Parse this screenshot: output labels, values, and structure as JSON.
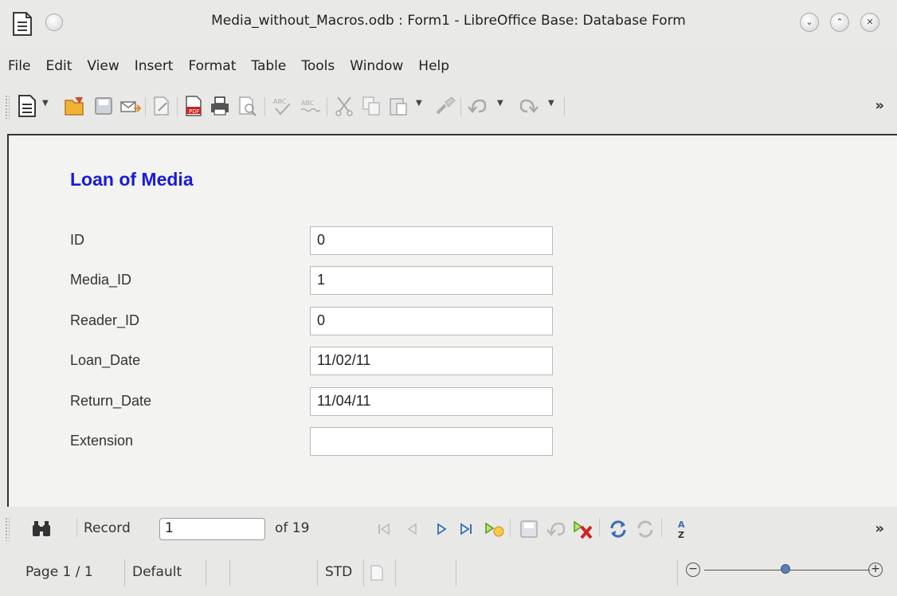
{
  "window": {
    "title": "Media_without_Macros.odb : Form1 - LibreOffice Base: Database Form",
    "controls": [
      "minimize",
      "maximize",
      "close"
    ]
  },
  "menu": [
    "File",
    "Edit",
    "View",
    "Insert",
    "Format",
    "Table",
    "Tools",
    "Window",
    "Help"
  ],
  "toolbar": {
    "icons": [
      "new-document-icon",
      "open-icon",
      "save-icon",
      "email-icon",
      "edit-file-icon",
      "export-pdf-icon",
      "print-icon",
      "print-preview-icon",
      "spellcheck-icon",
      "autospellcheck-icon",
      "cut-icon",
      "copy-icon",
      "paste-icon",
      "clone-formatting-icon",
      "undo-icon",
      "redo-icon"
    ],
    "more": "»"
  },
  "form": {
    "title": "Loan of Media",
    "fields": [
      {
        "label": "ID",
        "value": "0"
      },
      {
        "label": "Media_ID",
        "value": "1"
      },
      {
        "label": "Reader_ID",
        "value": "0"
      },
      {
        "label": "Loan_Date",
        "value": "11/02/11"
      },
      {
        "label": "Return_Date",
        "value": "11/04/11"
      },
      {
        "label": "Extension",
        "value": ""
      }
    ]
  },
  "navigation": {
    "record_label": "Record",
    "record_value": "1",
    "of_label": "of 19",
    "more": "»"
  },
  "status": {
    "page": "Page 1 / 1",
    "style": "Default",
    "mode": "STD"
  },
  "colors": {
    "form_title": "#1a1ad9",
    "background": "#e8e8e7"
  }
}
